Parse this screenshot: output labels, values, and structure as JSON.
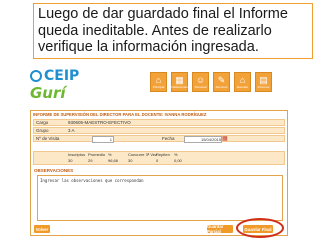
{
  "callout": {
    "text": "Luego de dar guardado final el Informe queda ineditable. Antes de realizarlo verifique la información ingresada."
  },
  "logos": {
    "ceip": "CEIP",
    "guri": "Gurí"
  },
  "toolbar": [
    {
      "label": "Principal",
      "icon": "home-icon",
      "glyph": "⌂"
    },
    {
      "label": "Instituciones",
      "icon": "building-icon",
      "glyph": "▦"
    },
    {
      "label": "Personal",
      "icon": "people-icon",
      "glyph": "☺"
    },
    {
      "label": "Alumnos",
      "icon": "student-icon",
      "glyph": "✎"
    },
    {
      "label": "Escuela",
      "icon": "school-icon",
      "glyph": "⌂"
    },
    {
      "label": "Informes",
      "icon": "report-icon",
      "glyph": "▤"
    }
  ],
  "form": {
    "title": "INFORME DE SUPERVISIÓN DEL DIRECTOR PARA EL DOCENTE: IVANNA RODRÍGUEZ",
    "cargo_label": "Cargo",
    "cargo_value": "930605-MAESTRO-EFECTIVO",
    "grupo_label": "Grupo",
    "grupo_value": "3 A",
    "visita_label": "Nº de Visita",
    "visita_value": "1",
    "fecha_label": "Fecha",
    "fecha_value": "15/04/2015",
    "stats_headers": [
      "Inscriptos",
      "Promedio",
      "%",
      "Concurre 3ª Vez",
      "Repiten",
      "%"
    ],
    "stats_values": [
      "30",
      "29",
      "96,66",
      "30",
      "0",
      "0,00"
    ],
    "obs_title": "OBSERVACIONES",
    "obs_text": "Ingresar las observaciones que correspondan"
  },
  "buttons": {
    "volver": "Volver",
    "parcial": "Guardar Parcial",
    "final": "Guardar Final"
  }
}
